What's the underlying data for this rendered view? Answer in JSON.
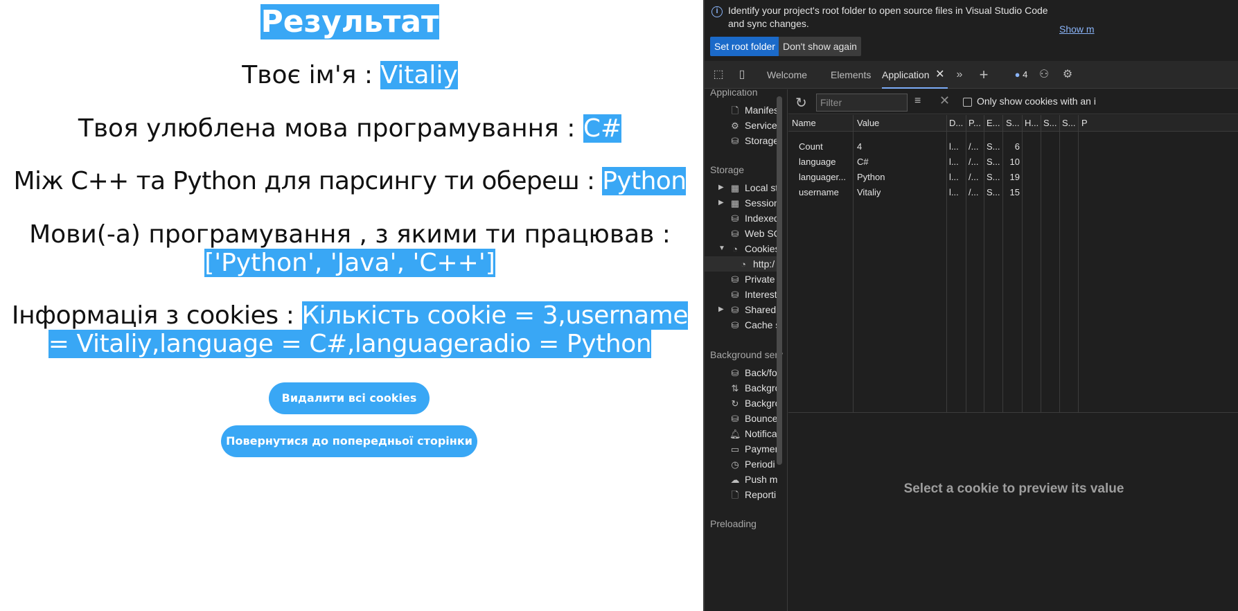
{
  "page": {
    "title": "Результат",
    "name_label": "Твоє ім'я : ",
    "name_value": "Vitaliy",
    "lang_label": "Твоя улюблена мова програмування : ",
    "lang_value": "C#",
    "radio_label": "Між C++ та Python для парсингу ти обереш : ",
    "radio_value": "Python",
    "langs_label": "Мови(-а) програмування , з якими ти працював :",
    "langs_value": "['Python', 'Java', 'C++']",
    "cookies_label": "Інформація з cookies : ",
    "cookies_value_line1": "Кількість cookie = 3,username",
    "cookies_value_line2": "= Vitaliy,language = C#,languageradio = Python",
    "delete_button": "Видалити всі cookies",
    "back_button": "Повернутися до попередньої сторінки"
  },
  "devtools": {
    "info_icon": "info-icon",
    "info_text": "Identify your project's root folder to open source files in Visual Studio Code and sync changes.",
    "show_more": "Show m",
    "set_root_button": "Set root folder",
    "dont_show_button": "Don't show again",
    "tabs": {
      "welcome": "Welcome",
      "elements": "Elements",
      "application": "Application",
      "issues_count": "4"
    },
    "sidebar": {
      "application_header": "Application",
      "application_items": [
        "Manifes",
        "Service",
        "Storage"
      ],
      "storage_header": "Storage",
      "storage_items": [
        "Local st",
        "Session",
        "Indexed",
        "Web SQ",
        "Cookies",
        "http:/",
        "Private",
        "Interest",
        "Shared",
        "Cache s"
      ],
      "background_header": "Background serv",
      "background_items": [
        "Back/fo",
        "Backgro",
        "Backgro",
        "Bounce",
        "Notifica",
        "Paymen",
        "Periodi",
        "Push m",
        "Reporti"
      ],
      "preloading_header": "Preloading"
    },
    "toolbar": {
      "filter_placeholder": "Filter",
      "only_show_label": "Only show cookies with an i"
    },
    "columns": [
      "Name",
      "Value",
      "D...",
      "P...",
      "E...",
      "S...",
      "H...",
      "S...",
      "S...",
      "P"
    ],
    "rows": [
      {
        "name": "Count",
        "value": "4",
        "domain": "l...",
        "path": "/...",
        "expires": "S...",
        "size": "6"
      },
      {
        "name": "language",
        "value": "C#",
        "domain": "l...",
        "path": "/...",
        "expires": "S...",
        "size": "10"
      },
      {
        "name": "languager...",
        "value": "Python",
        "domain": "l...",
        "path": "/...",
        "expires": "S...",
        "size": "19"
      },
      {
        "name": "username",
        "value": "Vitaliy",
        "domain": "l...",
        "path": "/...",
        "expires": "S...",
        "size": "15"
      }
    ],
    "preview_text": "Select a cookie to preview its value"
  },
  "colors": {
    "highlight": "#39a7f5",
    "devtools_bg": "#202020",
    "accent_button": "#1b6ac9"
  }
}
